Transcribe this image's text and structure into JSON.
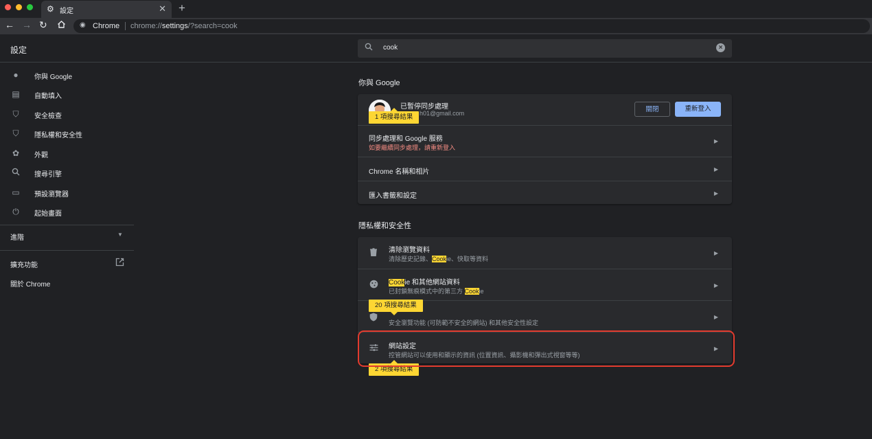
{
  "browser": {
    "tab_title": "設定",
    "omnibox_chip": "Chrome",
    "url_prefix": "chrome://",
    "url_bold": "settings",
    "url_suffix": "/?search=cook",
    "traffic_colors": [
      "#ff5f57",
      "#febc2e",
      "#28c840"
    ]
  },
  "header": {
    "title": "設定",
    "search_value": "cook"
  },
  "sidebar": {
    "items": [
      {
        "label": "你與 Google",
        "icon": "person-icon"
      },
      {
        "label": "自動填入",
        "icon": "clipboard-icon"
      },
      {
        "label": "安全檢查",
        "icon": "shield-check-icon"
      },
      {
        "label": "隱私權和安全性",
        "icon": "shield-icon"
      },
      {
        "label": "外觀",
        "icon": "palette-icon"
      },
      {
        "label": "搜尋引擎",
        "icon": "search-icon"
      },
      {
        "label": "預設瀏覽器",
        "icon": "browser-icon"
      },
      {
        "label": "起始畫面",
        "icon": "power-icon"
      }
    ],
    "advanced": "進階",
    "extensions": "擴充功能",
    "about": "關於 Chrome"
  },
  "you_and_google": {
    "section_title": "你與 Google",
    "profile_status": "已暫停同步處理",
    "profile_email": "h01@gmail.com",
    "close_button": "關閉",
    "relogin_button": "重新登入",
    "sync_title": "同步處理和 Google 服務",
    "sync_sub": "如要繼續同步處理，請重新登入",
    "name_title": "Chrome 名稱和相片",
    "import_title": "匯入書籤和設定",
    "bubble": "1 項搜尋結果"
  },
  "privacy": {
    "section_title": "隱私權和安全性",
    "clear_title": "清除瀏覽資料",
    "clear_sub_a": "清除歷史記錄、",
    "clear_sub_hl": "Cook",
    "clear_sub_b": "ie、快取等資料",
    "cookie_title_hl": "Cook",
    "cookie_title_b": "ie 和其他網站資料",
    "cookie_sub_a": "已封鎖無痕模式中的第三方 ",
    "cookie_sub_hl": "Cook",
    "cookie_sub_b": "ie",
    "security_sub": "安全瀏覽功能 (可防範不安全的網站) 和其他安全性設定",
    "site_title": "網站設定",
    "site_sub": "控管網站可以使用和顯示的資訊 (位置資訊、攝影機和彈出式視窗等等)",
    "bubble_security": "20 項搜尋結果",
    "bubble_site": "2 項搜尋結果"
  }
}
